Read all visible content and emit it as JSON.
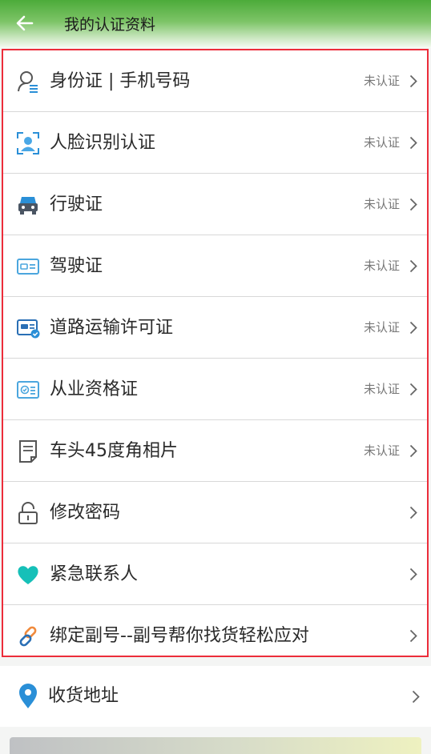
{
  "header": {
    "title": "我的认证资料"
  },
  "items": [
    {
      "label": "身份证 | 手机号码",
      "status": "未认证",
      "icon": "id-search-icon"
    },
    {
      "label": "人脸识别认证",
      "status": "未认证",
      "icon": "face-scan-icon"
    },
    {
      "label": "行驶证",
      "status": "未认证",
      "icon": "car-icon"
    },
    {
      "label": "驾驶证",
      "status": "未认证",
      "icon": "driver-license-icon"
    },
    {
      "label": "道路运输许可证",
      "status": "未认证",
      "icon": "transport-permit-icon"
    },
    {
      "label": "从业资格证",
      "status": "未认证",
      "icon": "qualification-card-icon"
    },
    {
      "label": "车头45度角相片",
      "status": "未认证",
      "icon": "photo-document-icon"
    },
    {
      "label": "修改密码",
      "status": "",
      "icon": "lock-icon"
    },
    {
      "label": "紧急联系人",
      "status": "",
      "icon": "heart-icon"
    },
    {
      "label": "绑定副号--副号帮你找货轻松应对",
      "status": "",
      "icon": "link-icon"
    }
  ],
  "address": {
    "label": "收货地址",
    "icon": "location-pin-icon"
  },
  "colors": {
    "accent_blue": "#2a8fd7",
    "highlight_border": "#ec2d3a",
    "header_green": "#4cab3a",
    "heart_teal": "#16c0b8"
  }
}
